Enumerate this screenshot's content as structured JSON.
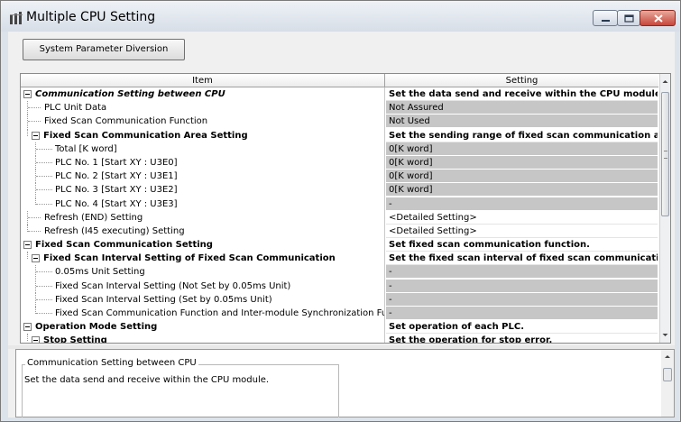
{
  "window": {
    "title": "Multiple CPU Setting"
  },
  "toolbar": {
    "diversion_button": "System Parameter Diversion"
  },
  "grid": {
    "headers": {
      "item": "Item",
      "setting": "Setting"
    },
    "rows": [
      {
        "item": "Communication Setting between CPU",
        "setting": "Set the data send and receive within the CPU module.",
        "style": "group"
      },
      {
        "item": "PLC Unit Data",
        "setting": "Not Assured",
        "style": "value"
      },
      {
        "item": "Fixed Scan Communication Function",
        "setting": "Not Used",
        "style": "value"
      },
      {
        "item": "Fixed Scan Communication Area Setting",
        "setting": "Set the sending range of fixed scan communication are...",
        "style": "group"
      },
      {
        "item": "Total [K word]",
        "setting": "0[K word]",
        "style": "value"
      },
      {
        "item": "PLC No. 1   [Start XY : U3E0]",
        "setting": "0[K word]",
        "style": "value"
      },
      {
        "item": "PLC No. 2   [Start XY : U3E1]",
        "setting": "0[K word]",
        "style": "value"
      },
      {
        "item": "PLC No. 3   [Start XY : U3E2]",
        "setting": "0[K word]",
        "style": "value"
      },
      {
        "item": "PLC No. 4   [Start XY : U3E3]",
        "setting": "-",
        "style": "value"
      },
      {
        "item": "Refresh (END) Setting",
        "setting": "<Detailed Setting>",
        "style": "link"
      },
      {
        "item": "Refresh (I45 executing) Setting",
        "setting": "<Detailed Setting>",
        "style": "link"
      },
      {
        "item": "Fixed Scan Communication Setting",
        "setting": "Set fixed scan communication function.",
        "style": "group"
      },
      {
        "item": "Fixed Scan Interval Setting of Fixed Scan Communication",
        "setting": "Set the fixed scan interval of fixed scan communication.",
        "style": "group"
      },
      {
        "item": "0.05ms Unit Setting",
        "setting": "-",
        "style": "value"
      },
      {
        "item": "Fixed Scan Interval Setting (Not Set by 0.05ms Unit)",
        "setting": "-",
        "style": "value"
      },
      {
        "item": "Fixed Scan Interval Setting (Set by 0.05ms Unit)",
        "setting": "-",
        "style": "value"
      },
      {
        "item": "Fixed Scan Communication Function and Inter-module Synchronization Function",
        "setting": "-",
        "style": "value"
      },
      {
        "item": "Operation Mode Setting",
        "setting": "Set operation of each PLC.",
        "style": "group"
      },
      {
        "item": "Stop Setting",
        "setting": "Set the operation for stop error.",
        "style": "group"
      }
    ]
  },
  "description": {
    "legend": "Communication Setting between CPU",
    "text": "Set the data send and receive within the CPU module."
  },
  "colors": {
    "setting_grey": "#c6c6c6",
    "close_button": "#c8463a"
  },
  "icons": {
    "app": "multiple-cpu-icon",
    "minimize": "minimize-icon",
    "maximize": "maximize-icon",
    "close": "close-icon"
  }
}
